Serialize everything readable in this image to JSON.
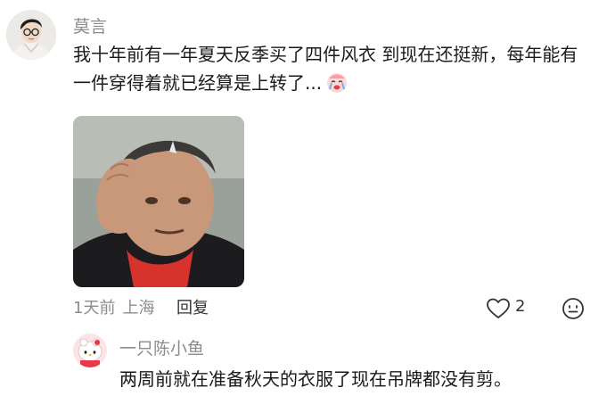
{
  "comment": {
    "username": "莫言",
    "text": "我十年前有一年夏天反季买了四件风衣 到现在还挺新，每年能有一件穿得着就已经算是上转了...",
    "emoji": "crying-face-emoji",
    "time": "1天前",
    "location": "上海",
    "reply_label": "回复",
    "likes": "2",
    "like_icon": "heart-outline-icon",
    "react_icon": "face-icon"
  },
  "reply": {
    "username": "一只陈小鱼",
    "text": "两周前就在准备秋天的衣服了现在吊牌都没有剪。"
  },
  "colors": {
    "muted": "#8c8c8c",
    "text": "#1a1a1a"
  }
}
